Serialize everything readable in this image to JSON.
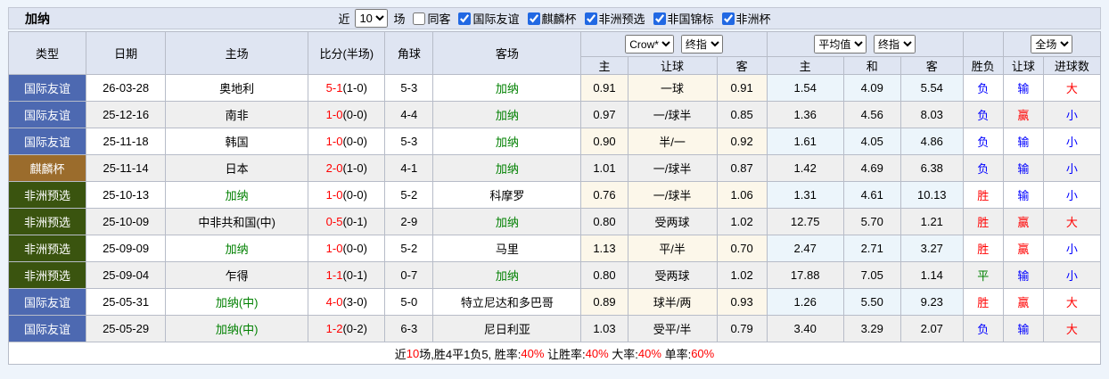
{
  "topbar": {
    "title": "加纳",
    "recent_prefix": "近",
    "recent_value": "10",
    "recent_suffix": "场",
    "same_away": {
      "label": "同客",
      "checked": false
    },
    "competitions": [
      {
        "label": "国际友谊",
        "checked": true
      },
      {
        "label": "麒麟杯",
        "checked": true
      },
      {
        "label": "非洲预选",
        "checked": true
      },
      {
        "label": "非国锦标",
        "checked": true
      },
      {
        "label": "非洲杯",
        "checked": true
      }
    ]
  },
  "header": {
    "col_headers": [
      "类型",
      "日期",
      "主场",
      "比分(半场)",
      "角球",
      "客场"
    ],
    "company_select": "Crow*",
    "final_select_a": "终指",
    "average_select": "平均值",
    "final_select_b": "终指",
    "scope_select": "全场",
    "sub_headers": [
      "主",
      "让球",
      "客",
      "主",
      "和",
      "客",
      "胜负",
      "让球",
      "进球数"
    ]
  },
  "rows": [
    {
      "type": {
        "label": "国际友谊",
        "bg": "#4d69b1"
      },
      "date": "26-03-28",
      "home": {
        "name": "奥地利",
        "color": "#000000"
      },
      "score": "5-1",
      "half_score": "(1-0)",
      "corners": "5-3",
      "away": {
        "name": "加纳",
        "color": "#008000"
      },
      "crown_odds": [
        "0.91",
        "一球",
        "0.91"
      ],
      "avg_odds": [
        "1.54",
        "4.09",
        "5.54"
      ],
      "outcome": {
        "label": "负",
        "color": "#0000ff"
      },
      "handicap": {
        "label": "输",
        "color": "#0000ff"
      },
      "goals": {
        "label": "大",
        "color": "#ff0000"
      }
    },
    {
      "type": {
        "label": "国际友谊",
        "bg": "#4d69b1"
      },
      "date": "25-12-16",
      "home": {
        "name": "南非",
        "color": "#000000"
      },
      "score": "1-0",
      "half_score": "(0-0)",
      "corners": "4-4",
      "away": {
        "name": "加纳",
        "color": "#008000"
      },
      "crown_odds": [
        "0.97",
        "一/球半",
        "0.85"
      ],
      "avg_odds": [
        "1.36",
        "4.56",
        "8.03"
      ],
      "outcome": {
        "label": "负",
        "color": "#0000ff"
      },
      "handicap": {
        "label": "赢",
        "color": "#ff0000"
      },
      "goals": {
        "label": "小",
        "color": "#0000ff"
      }
    },
    {
      "type": {
        "label": "国际友谊",
        "bg": "#4d69b1"
      },
      "date": "25-11-18",
      "home": {
        "name": "韩国",
        "color": "#000000"
      },
      "score": "1-0",
      "half_score": "(0-0)",
      "corners": "5-3",
      "away": {
        "name": "加纳",
        "color": "#008000"
      },
      "crown_odds": [
        "0.90",
        "半/一",
        "0.92"
      ],
      "avg_odds": [
        "1.61",
        "4.05",
        "4.86"
      ],
      "outcome": {
        "label": "负",
        "color": "#0000ff"
      },
      "handicap": {
        "label": "输",
        "color": "#0000ff"
      },
      "goals": {
        "label": "小",
        "color": "#0000ff"
      }
    },
    {
      "type": {
        "label": "麒麟杯",
        "bg": "#9b6c2c"
      },
      "date": "25-11-14",
      "home": {
        "name": "日本",
        "color": "#000000"
      },
      "score": "2-0",
      "half_score": "(1-0)",
      "corners": "4-1",
      "away": {
        "name": "加纳",
        "color": "#008000"
      },
      "crown_odds": [
        "1.01",
        "一/球半",
        "0.87"
      ],
      "avg_odds": [
        "1.42",
        "4.69",
        "6.38"
      ],
      "outcome": {
        "label": "负",
        "color": "#0000ff"
      },
      "handicap": {
        "label": "输",
        "color": "#0000ff"
      },
      "goals": {
        "label": "小",
        "color": "#0000ff"
      }
    },
    {
      "type": {
        "label": "非洲预选",
        "bg": "#3a540f"
      },
      "date": "25-10-13",
      "home": {
        "name": "加纳",
        "color": "#008000"
      },
      "score": "1-0",
      "half_score": "(0-0)",
      "corners": "5-2",
      "away": {
        "name": "科摩罗",
        "color": "#000000"
      },
      "crown_odds": [
        "0.76",
        "一/球半",
        "1.06"
      ],
      "avg_odds": [
        "1.31",
        "4.61",
        "10.13"
      ],
      "outcome": {
        "label": "胜",
        "color": "#ff0000"
      },
      "handicap": {
        "label": "输",
        "color": "#0000ff"
      },
      "goals": {
        "label": "小",
        "color": "#0000ff"
      }
    },
    {
      "type": {
        "label": "非洲预选",
        "bg": "#3a540f"
      },
      "date": "25-10-09",
      "home": {
        "name": "中非共和国(中)",
        "color": "#000000"
      },
      "score": "0-5",
      "half_score": "(0-1)",
      "corners": "2-9",
      "away": {
        "name": "加纳",
        "color": "#008000"
      },
      "crown_odds": [
        "0.80",
        "受两球",
        "1.02"
      ],
      "avg_odds": [
        "12.75",
        "5.70",
        "1.21"
      ],
      "outcome": {
        "label": "胜",
        "color": "#ff0000"
      },
      "handicap": {
        "label": "赢",
        "color": "#ff0000"
      },
      "goals": {
        "label": "大",
        "color": "#ff0000"
      }
    },
    {
      "type": {
        "label": "非洲预选",
        "bg": "#3a540f"
      },
      "date": "25-09-09",
      "home": {
        "name": "加纳",
        "color": "#008000"
      },
      "score": "1-0",
      "half_score": "(0-0)",
      "corners": "5-2",
      "away": {
        "name": "马里",
        "color": "#000000"
      },
      "crown_odds": [
        "1.13",
        "平/半",
        "0.70"
      ],
      "avg_odds": [
        "2.47",
        "2.71",
        "3.27"
      ],
      "outcome": {
        "label": "胜",
        "color": "#ff0000"
      },
      "handicap": {
        "label": "赢",
        "color": "#ff0000"
      },
      "goals": {
        "label": "小",
        "color": "#0000ff"
      }
    },
    {
      "type": {
        "label": "非洲预选",
        "bg": "#3a540f"
      },
      "date": "25-09-04",
      "home": {
        "name": "乍得",
        "color": "#000000"
      },
      "score": "1-1",
      "half_score": "(0-1)",
      "corners": "0-7",
      "away": {
        "name": "加纳",
        "color": "#008000"
      },
      "crown_odds": [
        "0.80",
        "受两球",
        "1.02"
      ],
      "avg_odds": [
        "17.88",
        "7.05",
        "1.14"
      ],
      "outcome": {
        "label": "平",
        "color": "#008000"
      },
      "handicap": {
        "label": "输",
        "color": "#0000ff"
      },
      "goals": {
        "label": "小",
        "color": "#0000ff"
      }
    },
    {
      "type": {
        "label": "国际友谊",
        "bg": "#4d69b1"
      },
      "date": "25-05-31",
      "home": {
        "name": "加纳(中)",
        "color": "#008000"
      },
      "score": "4-0",
      "half_score": "(3-0)",
      "corners": "5-0",
      "away": {
        "name": "特立尼达和多巴哥",
        "color": "#000000"
      },
      "crown_odds": [
        "0.89",
        "球半/两",
        "0.93"
      ],
      "avg_odds": [
        "1.26",
        "5.50",
        "9.23"
      ],
      "outcome": {
        "label": "胜",
        "color": "#ff0000"
      },
      "handicap": {
        "label": "赢",
        "color": "#ff0000"
      },
      "goals": {
        "label": "大",
        "color": "#ff0000"
      }
    },
    {
      "type": {
        "label": "国际友谊",
        "bg": "#4d69b1"
      },
      "date": "25-05-29",
      "home": {
        "name": "加纳(中)",
        "color": "#008000"
      },
      "score": "1-2",
      "half_score": "(0-2)",
      "corners": "6-3",
      "away": {
        "name": "尼日利亚",
        "color": "#000000"
      },
      "crown_odds": [
        "1.03",
        "受平/半",
        "0.79"
      ],
      "avg_odds": [
        "3.40",
        "3.29",
        "2.07"
      ],
      "outcome": {
        "label": "负",
        "color": "#0000ff"
      },
      "handicap": {
        "label": "输",
        "color": "#0000ff"
      },
      "goals": {
        "label": "大",
        "color": "#ff0000"
      }
    }
  ],
  "footer": {
    "segments": [
      {
        "text": "近",
        "color": "#000000"
      },
      {
        "text": "10",
        "color": "#ff0000"
      },
      {
        "text": "场,胜4平1负5, 胜率:",
        "color": "#000000"
      },
      {
        "text": "40%",
        "color": "#ff0000"
      },
      {
        "text": " 让胜率:",
        "color": "#000000"
      },
      {
        "text": "40%",
        "color": "#ff0000"
      },
      {
        "text": " 大率:",
        "color": "#000000"
      },
      {
        "text": "40%",
        "color": "#ff0000"
      },
      {
        "text": " 单率:",
        "color": "#000000"
      },
      {
        "text": "60%",
        "color": "#ff0000"
      }
    ]
  }
}
